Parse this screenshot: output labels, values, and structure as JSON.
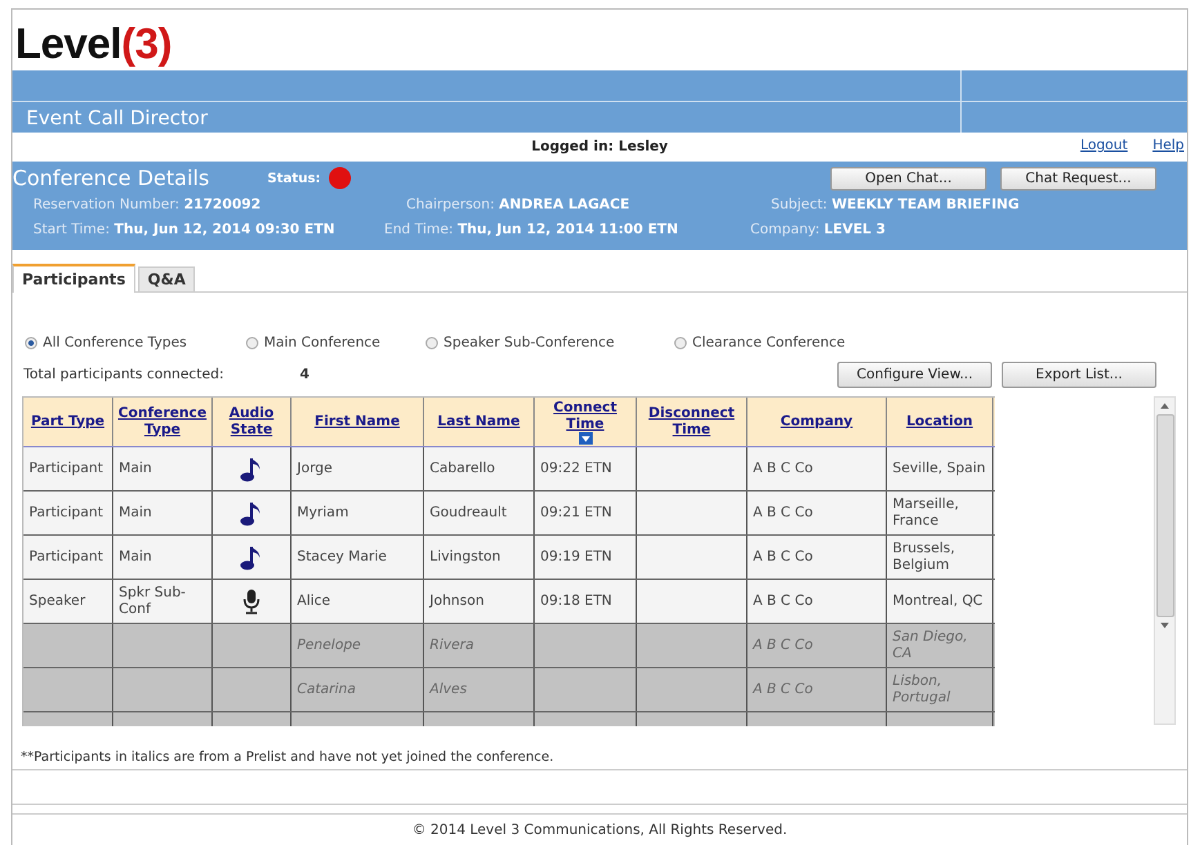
{
  "logo": {
    "word": "Level",
    "mark": "(3)"
  },
  "app_title": "Event Call Director",
  "session": {
    "logged_in_label": "Logged in:",
    "user": "Lesley",
    "links": [
      "Logout",
      "Help"
    ]
  },
  "conference": {
    "title": "Conference Details",
    "status_label": "Status:",
    "status_dot": {
      "color": "#e01010"
    },
    "buttons": [
      "Open Chat...",
      "Chat Request..."
    ],
    "fields": [
      [
        {
          "label": "Reservation Number:",
          "value": "21720092"
        },
        {
          "label": "Chairperson:",
          "value": "ANDREA LAGACE"
        },
        {
          "label": "Subject:",
          "value": "WEEKLY TEAM BRIEFING"
        }
      ],
      [
        {
          "label": "Start Time:",
          "value": "Thu, Jun 12, 2014 09:30 ETN"
        },
        {
          "label": "End Time:",
          "value": "Thu, Jun 12, 2014 11:00 ETN"
        },
        {
          "label": "Company:",
          "value": "LEVEL 3"
        }
      ]
    ]
  },
  "tabs": [
    {
      "label": "Participants",
      "selected": true
    },
    {
      "label": "Q&A",
      "selected": false
    }
  ],
  "filters": [
    {
      "label": "All Conference Types",
      "selected": true
    },
    {
      "label": "Main Conference",
      "selected": false
    },
    {
      "label": "Speaker Sub-Conference",
      "selected": false
    },
    {
      "label": "Clearance Conference",
      "selected": false
    }
  ],
  "total": {
    "label": "Total participants connected:",
    "value": "4"
  },
  "actions": [
    "Configure View...",
    "Export List..."
  ],
  "table": {
    "columns": [
      {
        "label": "Part Type",
        "sorted": false
      },
      {
        "label": "Conference Type",
        "sorted": false
      },
      {
        "label": "Audio State",
        "sorted": false
      },
      {
        "label": "First Name",
        "sorted": false
      },
      {
        "label": "Last Name",
        "sorted": false
      },
      {
        "label": "Connect Time",
        "sorted": true
      },
      {
        "label": "Disconnect Time",
        "sorted": false
      },
      {
        "label": "Company",
        "sorted": false
      },
      {
        "label": "Location",
        "sorted": false
      }
    ],
    "rows": [
      {
        "prelist": false,
        "part_type": "Participant",
        "conference_type": "Main",
        "audio": {
          "kind": "music"
        },
        "first_name": "Jorge",
        "last_name": "Cabarello",
        "connect_time": "09:22 ETN",
        "company": "A B C Co",
        "location": "Seville, Spain"
      },
      {
        "prelist": false,
        "part_type": "Participant",
        "conference_type": "Main",
        "audio": {
          "kind": "music"
        },
        "first_name": "Myriam",
        "last_name": "Goudreault",
        "connect_time": "09:21 ETN",
        "company": "A B C Co",
        "location": "Marseille, France"
      },
      {
        "prelist": false,
        "part_type": "Participant",
        "conference_type": "Main",
        "audio": {
          "kind": "music"
        },
        "first_name": "Stacey Marie",
        "last_name": "Livingston",
        "connect_time": "09:19 ETN",
        "company": "A B C Co",
        "location": "Brussels, Belgium"
      },
      {
        "prelist": false,
        "part_type": "Speaker",
        "conference_type": "Spkr Sub-Conf",
        "audio": {
          "kind": "microphone"
        },
        "first_name": "Alice",
        "last_name": "Johnson",
        "connect_time": "09:18 ETN",
        "company": "A B C Co",
        "location": "Montreal, QC"
      },
      {
        "prelist": true,
        "first_name": "Penelope",
        "last_name": "Rivera",
        "company": "A B C Co",
        "location": "San Diego, CA"
      },
      {
        "prelist": true,
        "first_name": "Catarina",
        "last_name": "Alves",
        "company": "A B C Co",
        "location": "Lisbon, Portugal"
      }
    ]
  },
  "footnote": "**Participants in italics are from a Prelist and have not yet joined the conference.",
  "copyright": "© 2014 Level 3 Communications, All Rights Reserved."
}
